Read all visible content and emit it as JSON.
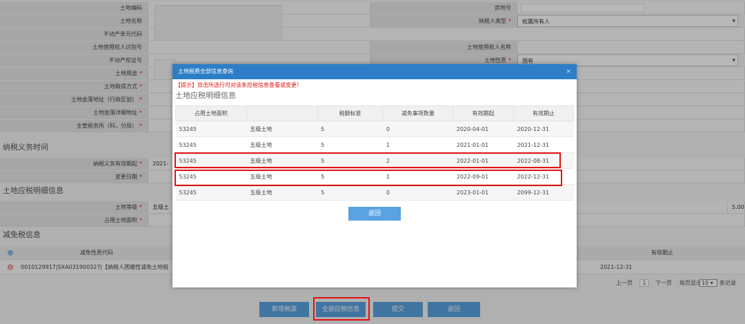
{
  "form": {
    "rows": [
      {
        "label": "土地编码",
        "right_label": "宗地号"
      },
      {
        "label": "土地名称",
        "right_label": "纳税人类型",
        "right_value": "权属所有人"
      },
      {
        "label": "不动产单元代码"
      },
      {
        "label": "土地使用权人识别号",
        "right_label": "土地使用权人名称"
      },
      {
        "label": "不动产权证号",
        "right_label": "土地性质",
        "right_value": "国有"
      },
      {
        "label": "土地用途"
      },
      {
        "label": "土地取得方式"
      },
      {
        "label": "土地坐落地址（行政区划）"
      },
      {
        "label": "土地坐落详细地址"
      },
      {
        "label": "主管税务所（科，分局）"
      }
    ],
    "section_obligation": "纳税义务时间",
    "obligation_start_label": "纳税义务有效期起",
    "obligation_start_value": "2021-",
    "change_date_label": "变更日期",
    "section_detail": "土地应税明细信息",
    "land_grade_label": "土地等级",
    "land_grade_value": "五级土",
    "land_grade_right": "5.00",
    "occupied_area_label": "占用土地面积",
    "section_reduction": "减免税信息",
    "reduction_col_code": "减免性质代码",
    "reduction_col_end": "有效期止",
    "reduction_row_code": "0010129917|SXA031900327|【纳税人困难性减免土地税",
    "reduction_row_end": "2021-12-31",
    "pager": {
      "prev": "上一页",
      "page": "1",
      "next": "下一页",
      "per_page_label": "每页显示",
      "per_page_value": "10",
      "suffix": "条记录"
    }
  },
  "bottom_buttons": {
    "add": "新增税源",
    "all": "全部应税信息",
    "submit": "提交",
    "back": "返回"
  },
  "modal": {
    "title": "土地税费全部信息查询",
    "close": "×",
    "tip": "【提示】双击所选行可对该条应税信息查看或变更！",
    "heading": "土地应税明细信息",
    "columns": [
      "占用土地面积",
      "",
      "税额标准",
      "减免事项数量",
      "有效期起",
      "有效期止"
    ],
    "rows": [
      [
        "53245",
        "五级土地",
        "5",
        "0",
        "2020-04-01",
        "2020-12-31"
      ],
      [
        "53245",
        "五级土地",
        "5",
        "1",
        "2021-01-01",
        "2021-12-31"
      ],
      [
        "53245",
        "五级土地",
        "5",
        "2",
        "2022-01-01",
        "2022-08-31"
      ],
      [
        "53245",
        "五级土地",
        "5",
        "1",
        "2022-09-01",
        "2022-12-31"
      ],
      [
        "53245",
        "五级土地",
        "5",
        "0",
        "2023-01-01",
        "2099-12-31"
      ]
    ],
    "back_button": "返回"
  },
  "colors": {
    "accent": "#5aa2e0",
    "modal_header": "#2d7ec6",
    "highlight": "#e01010"
  }
}
